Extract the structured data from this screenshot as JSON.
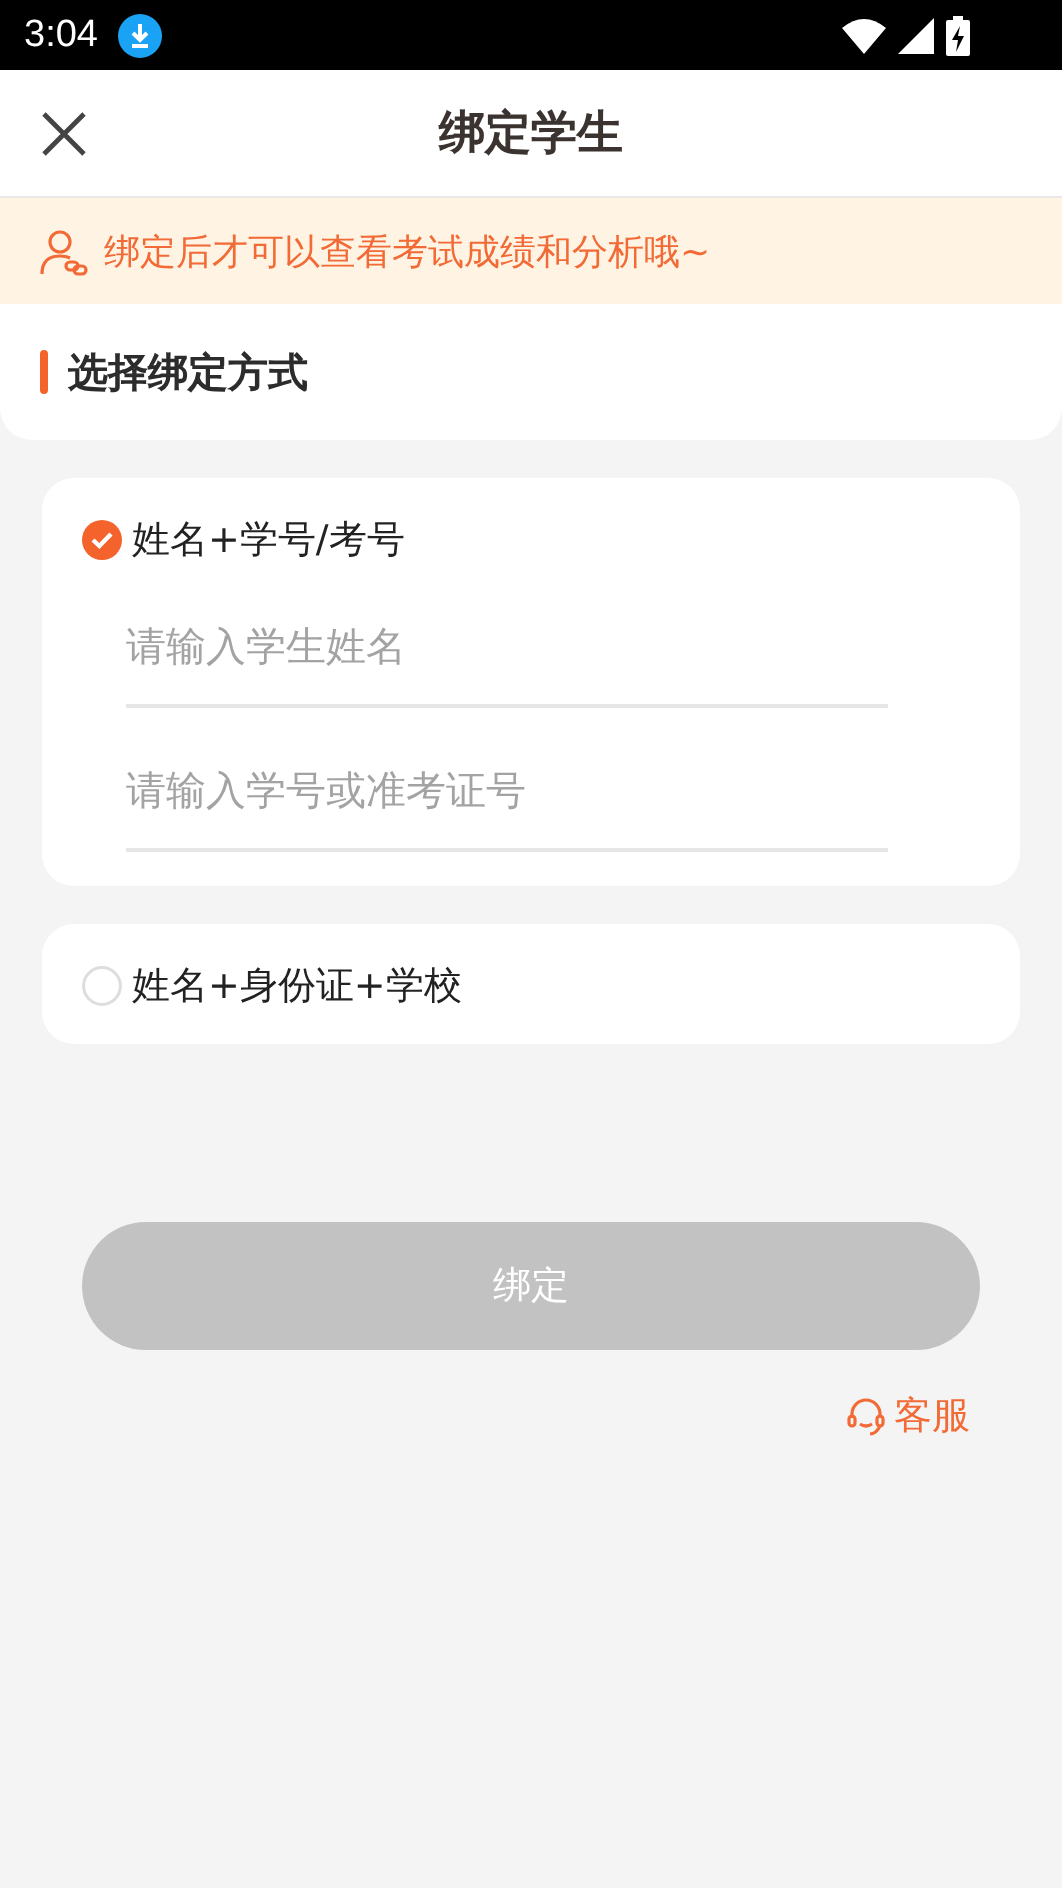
{
  "status_bar": {
    "time": "3:04"
  },
  "header": {
    "title": "绑定学生"
  },
  "notice": {
    "text": "绑定后才可以查看考试成绩和分析哦~"
  },
  "section": {
    "title": "选择绑定方式"
  },
  "options": [
    {
      "label": "姓名+学号/考号",
      "selected": true,
      "fields": [
        {
          "placeholder": "请输入学生姓名"
        },
        {
          "placeholder": "请输入学号或准考证号"
        }
      ]
    },
    {
      "label": "姓名+身份证+学校",
      "selected": false
    }
  ],
  "bind_button": {
    "label": "绑定",
    "disabled": true
  },
  "support_link": {
    "label": "客服"
  }
}
